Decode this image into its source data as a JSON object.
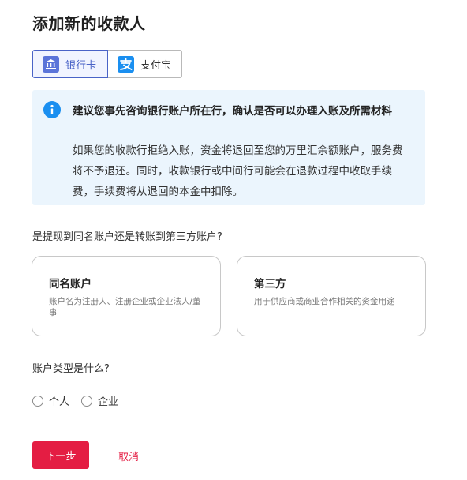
{
  "page": {
    "title": "添加新的收款人"
  },
  "method_tabs": [
    {
      "label": "银行卡",
      "icon": "bank-icon",
      "selected": true
    },
    {
      "label": "支付宝",
      "icon": "alipay-icon",
      "selected": false
    }
  ],
  "notice": {
    "icon": "info-icon",
    "title": "建议您事先咨询银行账户所在行，确认是否可以办理入账及所需材料",
    "body": "如果您的收款行拒绝入账，资金将退回至您的万里汇余额账户，服务费将不予退还。同时，收款银行或中间行可能会在退款过程中收取手续费，手续费将从退回的本金中扣除。"
  },
  "account_owner": {
    "question": "是提现到同名账户还是转账到第三方账户?",
    "options": [
      {
        "title": "同名账户",
        "description": "账户名为注册人、注册企业或企业法人/董事"
      },
      {
        "title": "第三方",
        "description": "用于供应商或商业合作相关的资金用途"
      }
    ]
  },
  "account_type": {
    "question": "账户类型是什么?",
    "options": [
      {
        "label": "个人",
        "checked": false
      },
      {
        "label": "企业",
        "checked": false
      }
    ]
  },
  "actions": {
    "next_label": "下一步",
    "cancel_label": "取消"
  },
  "colors": {
    "primary": "#e41d43",
    "tab_selected": "#4a63c7",
    "notice_bg": "#ebf5fd",
    "info_icon": "#1a8ff0"
  }
}
